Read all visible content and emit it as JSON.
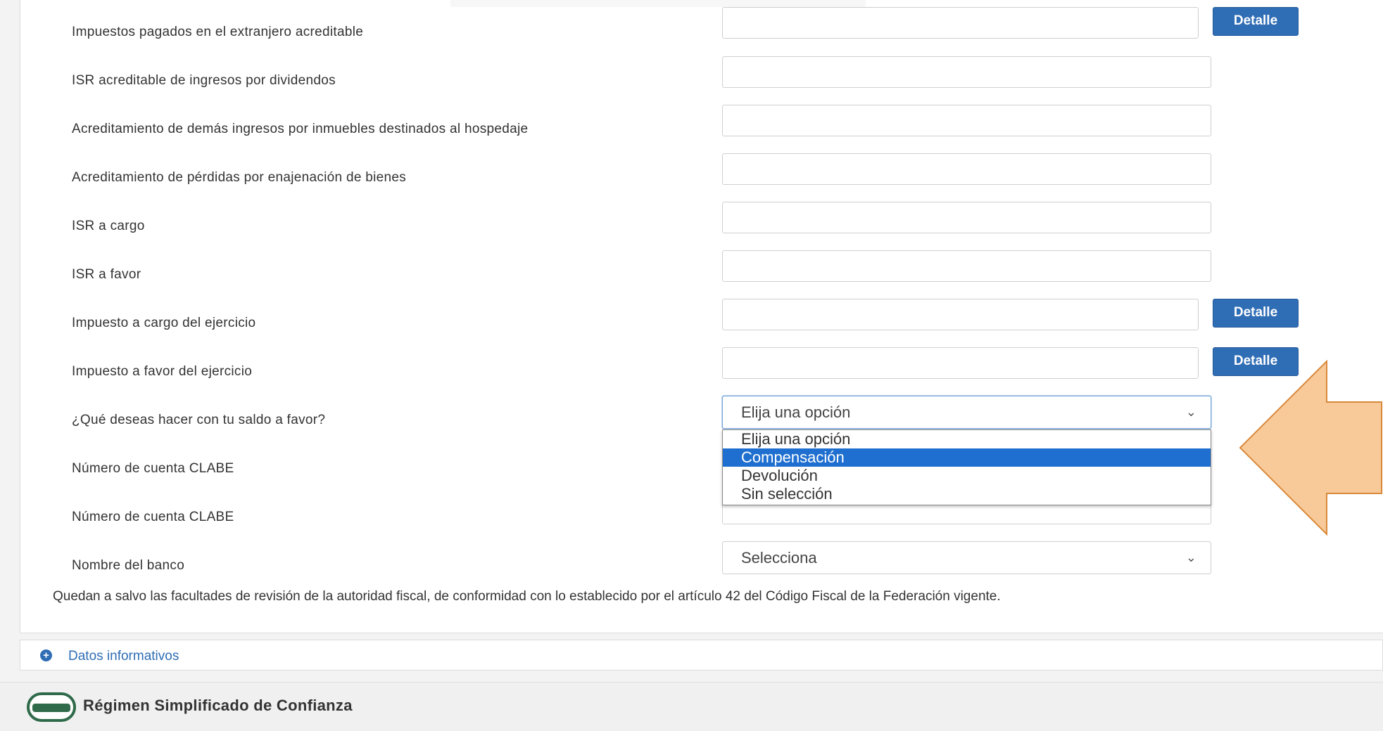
{
  "rows": [
    {
      "label": "Impuestos pagados en el extranjero acreditable",
      "value": "",
      "detail_label": "Detalle"
    },
    {
      "label": "ISR acreditable de ingresos por dividendos",
      "value": ""
    },
    {
      "label": "Acreditamiento de demás ingresos por inmuebles destinados al hospedaje",
      "value": ""
    },
    {
      "label": "Acreditamiento de pérdidas por enajenación de bienes",
      "value": ""
    },
    {
      "label": "ISR a cargo",
      "value": ""
    },
    {
      "label": "ISR a favor",
      "value": ""
    },
    {
      "label": "Impuesto a cargo del ejercicio",
      "value": "",
      "detail_label": "Detalle"
    },
    {
      "label": "Impuesto a favor del ejercicio",
      "value": "",
      "detail_label": "Detalle"
    },
    {
      "label": "¿Qué deseas hacer con tu saldo a favor?"
    },
    {
      "label": "Número de cuenta CLABE"
    },
    {
      "label": "Número de cuenta CLABE"
    },
    {
      "label": "Nombre del banco"
    }
  ],
  "saldo_select": {
    "value": "Elija una opción",
    "options": [
      "Elija una opción",
      "Compensación",
      "Devolución",
      "Sin selección"
    ],
    "highlighted": "Compensación"
  },
  "banco_select": {
    "value": "Selecciona"
  },
  "note": "Quedan a salvo las facultades de revisión de la autoridad fiscal, de conformidad con lo establecido por el artículo 42 del Código Fiscal de la Federación vigente.",
  "datos_informativos": {
    "label": "Datos informativos",
    "icon": "plus-circle-icon"
  },
  "footer": {
    "title": "Régimen Simplificado de Confianza",
    "logo": "resico-logo"
  },
  "colors": {
    "primary": "#2f6db5",
    "highlight": "#1f6fd0",
    "arrow_fill": "#f8c999",
    "arrow_stroke": "#d88a3a"
  }
}
